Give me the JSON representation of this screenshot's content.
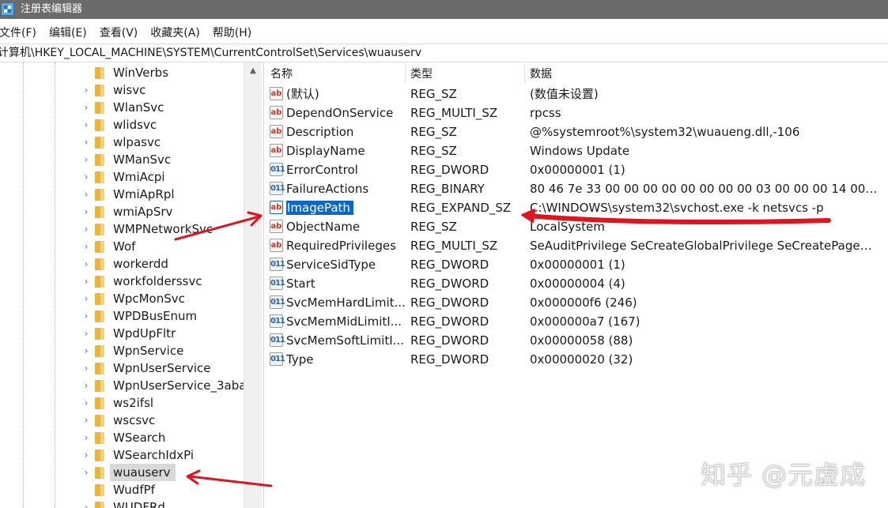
{
  "window": {
    "title": "注册表编辑器"
  },
  "menu": [
    {
      "label": "文件(F)"
    },
    {
      "label": "编辑(E)"
    },
    {
      "label": "查看(V)"
    },
    {
      "label": "收藏夹(A)"
    },
    {
      "label": "帮助(H)"
    }
  ],
  "address": {
    "path": "计算机\\HKEY_LOCAL_MACHINE\\SYSTEM\\CurrentControlSet\\Services\\wuauserv"
  },
  "tree": {
    "items": [
      {
        "label": "WinVerbs",
        "expandable": false
      },
      {
        "label": "wisvc",
        "expandable": true
      },
      {
        "label": "WlanSvc",
        "expandable": true
      },
      {
        "label": "wlidsvc",
        "expandable": true
      },
      {
        "label": "wlpasvc",
        "expandable": true
      },
      {
        "label": "WManSvc",
        "expandable": true
      },
      {
        "label": "WmiAcpi",
        "expandable": true
      },
      {
        "label": "WmiApRpl",
        "expandable": true
      },
      {
        "label": "wmiApSrv",
        "expandable": true
      },
      {
        "label": "WMPNetworkSvc",
        "expandable": true
      },
      {
        "label": "Wof",
        "expandable": true
      },
      {
        "label": "workerdd",
        "expandable": true
      },
      {
        "label": "workfolderssvc",
        "expandable": true
      },
      {
        "label": "WpcMonSvc",
        "expandable": true
      },
      {
        "label": "WPDBusEnum",
        "expandable": true
      },
      {
        "label": "WpdUpFltr",
        "expandable": true
      },
      {
        "label": "WpnService",
        "expandable": true
      },
      {
        "label": "WpnUserService",
        "expandable": true
      },
      {
        "label": "WpnUserService_3aba",
        "expandable": true
      },
      {
        "label": "ws2ifsl",
        "expandable": true
      },
      {
        "label": "wscsvc",
        "expandable": true
      },
      {
        "label": "WSearch",
        "expandable": true
      },
      {
        "label": "WSearchIdxPi",
        "expandable": true
      },
      {
        "label": "wuauserv",
        "expandable": true,
        "selected": true
      },
      {
        "label": "WudfPf",
        "expandable": false
      },
      {
        "label": "WUDFRd",
        "expandable": true
      }
    ]
  },
  "list": {
    "headers": {
      "name": "名称",
      "type": "类型",
      "data": "数据"
    },
    "rows": [
      {
        "icon": "string-value-icon",
        "name": "(默认)",
        "type": "REG_SZ",
        "data": "(数值未设置)"
      },
      {
        "icon": "string-value-icon",
        "name": "DependOnService",
        "type": "REG_MULTI_SZ",
        "data": "rpcss"
      },
      {
        "icon": "string-value-icon",
        "name": "Description",
        "type": "REG_SZ",
        "data": "@%systemroot%\\system32\\wuaueng.dll,-106"
      },
      {
        "icon": "string-value-icon",
        "name": "DisplayName",
        "type": "REG_SZ",
        "data": "Windows Update"
      },
      {
        "icon": "binary-value-icon",
        "name": "ErrorControl",
        "type": "REG_DWORD",
        "data": "0x00000001 (1)"
      },
      {
        "icon": "binary-value-icon",
        "name": "FailureActions",
        "type": "REG_BINARY",
        "data": "80 46 7e 33 00 00 00 00 00 00 00 00 03 00 00 00 14 00 00 0..."
      },
      {
        "icon": "string-value-icon",
        "name": "ImagePath",
        "type": "REG_EXPAND_SZ",
        "data": "C:\\WINDOWS\\system32\\svchost.exe -k netsvcs -p",
        "selected": true
      },
      {
        "icon": "string-value-icon",
        "name": "ObjectName",
        "type": "REG_SZ",
        "data": "LocalSystem"
      },
      {
        "icon": "string-value-icon",
        "name": "RequiredPrivileges",
        "type": "REG_MULTI_SZ",
        "data": "SeAuditPrivilege SeCreateGlobalPrivilege SeCreatePageFil..."
      },
      {
        "icon": "binary-value-icon",
        "name": "ServiceSidType",
        "type": "REG_DWORD",
        "data": "0x00000001 (1)"
      },
      {
        "icon": "binary-value-icon",
        "name": "Start",
        "type": "REG_DWORD",
        "data": "0x00000004 (4)"
      },
      {
        "icon": "binary-value-icon",
        "name": "SvcMemHardLimit...",
        "type": "REG_DWORD",
        "data": "0x000000f6 (246)"
      },
      {
        "icon": "binary-value-icon",
        "name": "SvcMemMidLimitI...",
        "type": "REG_DWORD",
        "data": "0x000000a7 (167)"
      },
      {
        "icon": "binary-value-icon",
        "name": "SvcMemSoftLimitI...",
        "type": "REG_DWORD",
        "data": "0x00000058 (88)"
      },
      {
        "icon": "binary-value-icon",
        "name": "Type",
        "type": "REG_DWORD",
        "data": "0x00000020 (32)"
      }
    ]
  },
  "watermark": {
    "text": "知乎 @元虚成"
  },
  "annotation_color": "#e0141e"
}
